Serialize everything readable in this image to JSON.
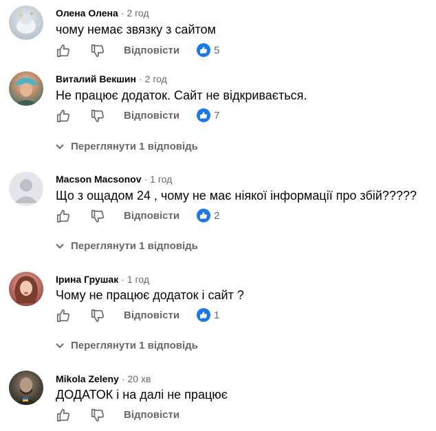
{
  "comments": [
    {
      "author": "Олена Олена",
      "time": "2 год",
      "text": "чому немає звязку з сайтом",
      "reply_label": "Відповісти",
      "likes": "5",
      "avatar_icon": "user-photo-avatar"
    },
    {
      "author": "Виталий Векшин",
      "time": "2 год",
      "text": "Не працює додаток. Сайт не відкривається.",
      "reply_label": "Відповісти",
      "likes": "7",
      "view_replies": "Переглянути 1 відповідь",
      "avatar_icon": "user-photo-avatar"
    },
    {
      "author": "Macson Macsonov",
      "time": "1 год",
      "text": "Що з ощадом 24 , чому не має ніякої інформації про збій?????",
      "reply_label": "Відповісти",
      "likes": "2",
      "view_replies": "Переглянути 1 відповідь",
      "avatar_icon": "default-user-avatar"
    },
    {
      "author": "Ірина Грушак",
      "time": "1 год",
      "text": "Чому не працює додаток і сайт ?",
      "reply_label": "Відповісти",
      "likes": "1",
      "view_replies": "Переглянути 1 відповідь",
      "avatar_icon": "user-photo-avatar"
    },
    {
      "author": "Mikola Zeleny",
      "time": "20 хв",
      "text": "ДОДАТОК і на далі не працює",
      "reply_label": "Відповісти",
      "avatar_icon": "user-photo-avatar"
    }
  ],
  "colors": {
    "like_blue": "#1877f2",
    "secondary_text": "#65676b"
  }
}
